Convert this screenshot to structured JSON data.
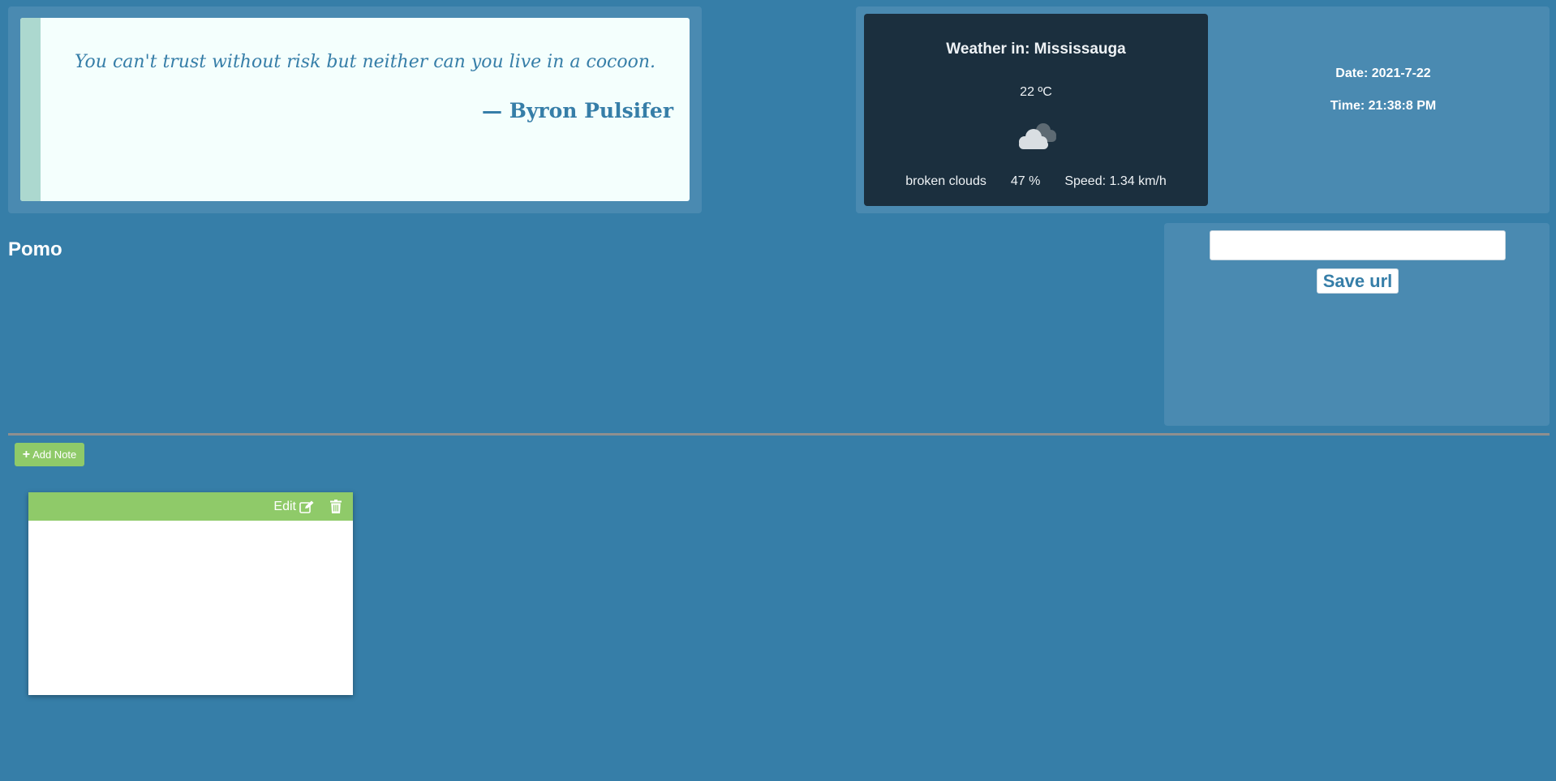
{
  "quote": {
    "text": "You can't trust without risk but neither can you live in a cocoon.",
    "author": "— Byron Pulsifer"
  },
  "weather": {
    "title": "Weather in: Mississauga",
    "temperature": "22 ºC",
    "icon": "broken-clouds-icon",
    "description": "broken clouds",
    "humidity": "47 %",
    "wind": "Speed: 1.34 km/h"
  },
  "datetime": {
    "date": "Date: 2021-7-22",
    "time": "Time: 21:38:8 PM"
  },
  "pomo": {
    "title": "Pomo"
  },
  "url_form": {
    "value": "",
    "save_label": "Save url"
  },
  "notes": {
    "add_label": "Add Note",
    "items": [
      {
        "edit_label": "Edit",
        "content": ""
      }
    ]
  },
  "colors": {
    "background": "#367ea8",
    "panel": "#4a8ab1",
    "weather_card": "#1b2f3e",
    "note_accent": "#8fca69",
    "quote_bar": "#acd8cf"
  }
}
